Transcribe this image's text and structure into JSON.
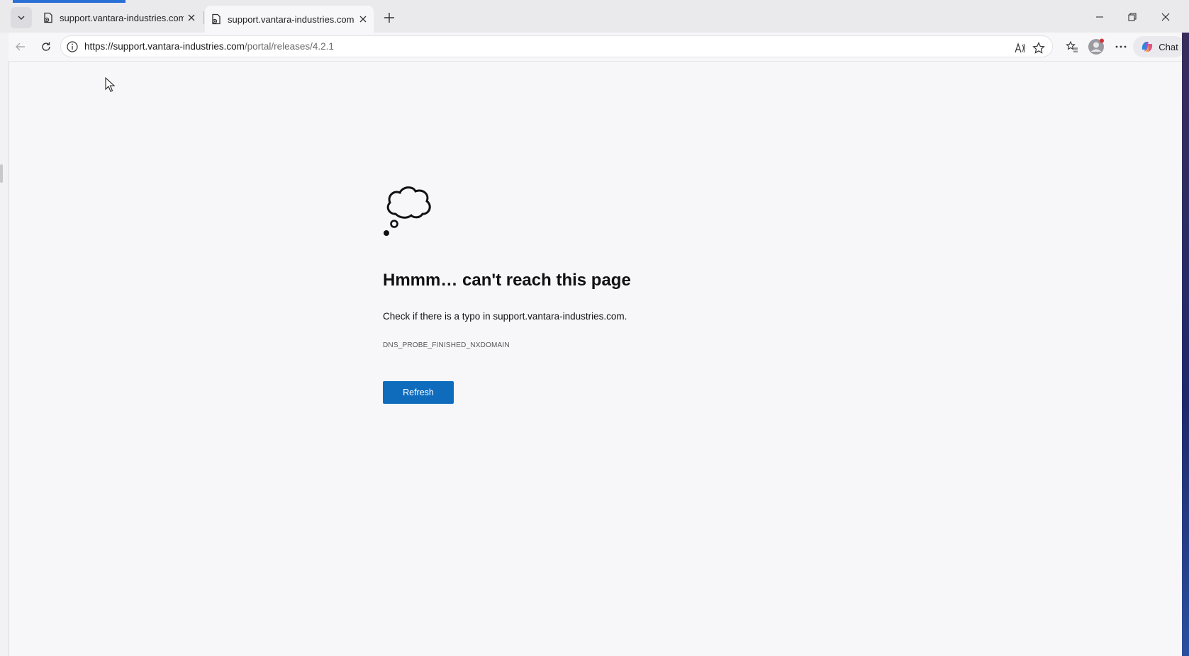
{
  "tabs": [
    {
      "title": "support.vantara-industries.com",
      "active": false
    },
    {
      "title": "support.vantara-industries.com",
      "active": true
    }
  ],
  "address": {
    "url_host": "https://support.vantara-industries.com",
    "url_path": "/portal/releases/4.2.1"
  },
  "toolbar": {
    "chat_label": "Chat"
  },
  "error": {
    "heading": "Hmmm… can't reach this page",
    "message": "Check if there is a typo in support.vantara-industries.com.",
    "code": "DNS_PROBE_FINISHED_NXDOMAIN",
    "refresh_label": "Refresh"
  },
  "colors": {
    "accent": "#0f6cbd",
    "load_bar": "#2a6fd6",
    "titlebar": "#eaeaed",
    "page_bg": "#f7f7f9"
  },
  "icons": [
    "tab-actions-chevron-icon",
    "page-favicon-icon",
    "close-icon",
    "plus-icon",
    "minimize-icon",
    "restore-icon",
    "back-icon",
    "reload-icon",
    "info-icon",
    "read-aloud-icon",
    "favorite-star-icon",
    "favorites-icon",
    "profile-avatar-icon",
    "more-icon",
    "copilot-icon",
    "thought-cloud-icon"
  ]
}
